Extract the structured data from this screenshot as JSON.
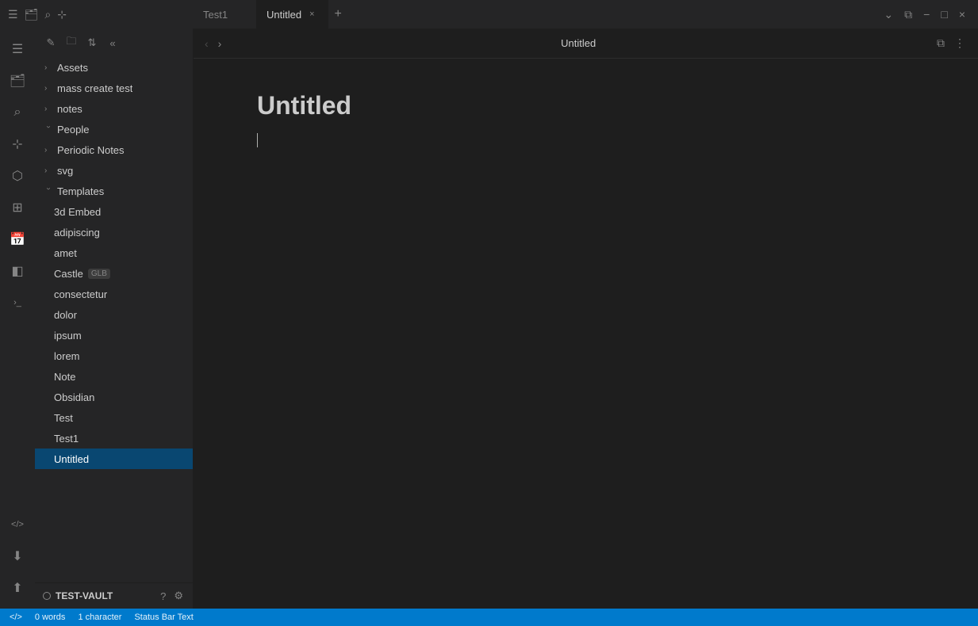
{
  "titleBar": {
    "tab1_label": "Test1",
    "tab2_label": "Untitled",
    "tab2_close": "×",
    "tab_new": "+",
    "center_title": "Untitled",
    "controls": {
      "chevron_down": "⌄",
      "split": "⧉",
      "minimize": "−",
      "maximize": "□",
      "close": "×"
    }
  },
  "activityBar": {
    "icons": [
      {
        "name": "sidebar-toggle-icon",
        "symbol": "☰"
      },
      {
        "name": "folder-icon",
        "symbol": "🗂"
      },
      {
        "name": "search-icon",
        "symbol": "🔍"
      },
      {
        "name": "bookmark-icon",
        "symbol": "🔖"
      },
      {
        "name": "graph-icon",
        "symbol": "⬡"
      },
      {
        "name": "puzzle-icon",
        "symbol": "⊞"
      },
      {
        "name": "calendar-icon",
        "symbol": "📅"
      },
      {
        "name": "document-icon",
        "symbol": "📄"
      },
      {
        "name": "terminal-icon",
        "symbol": ">_"
      },
      {
        "name": "tag-icon",
        "symbol": "</>"
      },
      {
        "name": "download-icon",
        "symbol": "⬇"
      },
      {
        "name": "upload-icon",
        "symbol": "⬆"
      }
    ]
  },
  "sidebar": {
    "toolbar": {
      "new_note": "✎",
      "new_folder": "📁",
      "sort": "↕",
      "collapse": "«"
    },
    "items": [
      {
        "id": "assets",
        "label": "Assets",
        "type": "folder",
        "expanded": false,
        "indent": 0
      },
      {
        "id": "mass-create-test",
        "label": "mass create test",
        "type": "folder",
        "expanded": false,
        "indent": 0
      },
      {
        "id": "notes",
        "label": "notes",
        "type": "folder",
        "expanded": false,
        "indent": 0
      },
      {
        "id": "people",
        "label": "People",
        "type": "folder",
        "expanded": true,
        "indent": 0
      },
      {
        "id": "periodic-notes",
        "label": "Periodic Notes",
        "type": "folder",
        "expanded": false,
        "indent": 0
      },
      {
        "id": "svg",
        "label": "svg",
        "type": "folder",
        "expanded": false,
        "indent": 0
      },
      {
        "id": "templates",
        "label": "Templates",
        "type": "folder",
        "expanded": true,
        "indent": 0
      },
      {
        "id": "3d-embed",
        "label": "3d Embed",
        "type": "file",
        "indent": 1
      },
      {
        "id": "adipiscing",
        "label": "adipiscing",
        "type": "file",
        "indent": 1
      },
      {
        "id": "amet",
        "label": "amet",
        "type": "file",
        "indent": 1
      },
      {
        "id": "castle",
        "label": "Castle",
        "type": "file",
        "indent": 1,
        "badge": "GLB"
      },
      {
        "id": "consectetur",
        "label": "consectetur",
        "type": "file",
        "indent": 1
      },
      {
        "id": "dolor",
        "label": "dolor",
        "type": "file",
        "indent": 1
      },
      {
        "id": "ipsum",
        "label": "ipsum",
        "type": "file",
        "indent": 1
      },
      {
        "id": "lorem",
        "label": "lorem",
        "type": "file",
        "indent": 1
      },
      {
        "id": "note",
        "label": "Note",
        "type": "file",
        "indent": 1
      },
      {
        "id": "obsidian",
        "label": "Obsidian",
        "type": "file",
        "indent": 1
      },
      {
        "id": "test",
        "label": "Test",
        "type": "file",
        "indent": 1
      },
      {
        "id": "test1",
        "label": "Test1",
        "type": "file",
        "indent": 1
      },
      {
        "id": "untitled",
        "label": "Untitled",
        "type": "file",
        "indent": 1,
        "selected": true
      }
    ],
    "footer": {
      "vault_name": "TEST-VAULT",
      "help_icon": "?",
      "settings_icon": "⚙"
    }
  },
  "editor": {
    "nav": {
      "back": "‹",
      "forward": "›"
    },
    "title": "Untitled",
    "actions": {
      "split": "⧉",
      "more": "⋮"
    },
    "content": {
      "note_title": "Untitled"
    }
  },
  "statusBar": {
    "left": [
      {
        "id": "code-icon",
        "label": "</>"
      },
      {
        "id": "word-count",
        "label": "0 words"
      },
      {
        "id": "char-count",
        "label": "1 character"
      },
      {
        "id": "status-text",
        "label": "Status Bar Text"
      }
    ]
  }
}
